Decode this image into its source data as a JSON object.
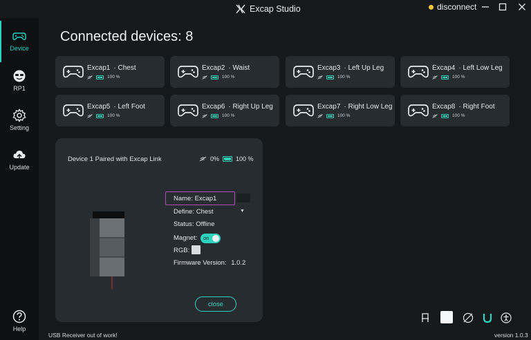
{
  "window": {
    "title": "Excap Studio",
    "connection_status": "disconnect",
    "status_color": "#f5c338"
  },
  "sidebar": {
    "items": [
      {
        "label": "Device",
        "icon": "gamepad-icon",
        "active": true
      },
      {
        "label": "RP1",
        "icon": "face-icon",
        "active": false
      },
      {
        "label": "Setting",
        "icon": "gear-icon",
        "active": false
      },
      {
        "label": "Update",
        "icon": "cloud-upload-icon",
        "active": false
      },
      {
        "label": "Help",
        "icon": "help-icon",
        "active": false
      }
    ]
  },
  "main": {
    "heading": "Connected devices: 8"
  },
  "devices": [
    {
      "name": "Excap1",
      "part": "· Chest",
      "signal": "100 %"
    },
    {
      "name": "Excap2",
      "part": "· Waist",
      "signal": "100 %"
    },
    {
      "name": "Excap3",
      "part": "· Left Up Leg",
      "signal": "100 %"
    },
    {
      "name": "Excap4",
      "part": "· Left Low Leg",
      "signal": "100 %"
    },
    {
      "name": "Excap5",
      "part": "· Left Foot",
      "signal": "100 %"
    },
    {
      "name": "Excap6",
      "part": "· Right Up Leg",
      "signal": "100 %"
    },
    {
      "name": "Excap7",
      "part": "· Right Low Leg",
      "signal": "100 %"
    },
    {
      "name": "Excap8",
      "part": "· Right Foot",
      "signal": "100 %"
    }
  ],
  "detail": {
    "title": "Device 1 Paired with Excap Link",
    "signal": "0%",
    "battery": "100 %",
    "name_label": "Name: Excap1",
    "define_label": "Define: Chest",
    "status_label": "Status: Offline",
    "magnet_label": "Magnet:",
    "magnet_state": "on",
    "rgb_label": "RGB:",
    "firmware_label": "Firmware Version:",
    "firmware_value": "1.0.2",
    "close_label": "close"
  },
  "footer": {
    "message": "USB Receiver out of work!",
    "version": "version 1.0.3"
  },
  "colors": {
    "accent": "#2ed3c0",
    "background": "#15191c",
    "card": "#262c30",
    "highlight": "#b04bb5"
  }
}
